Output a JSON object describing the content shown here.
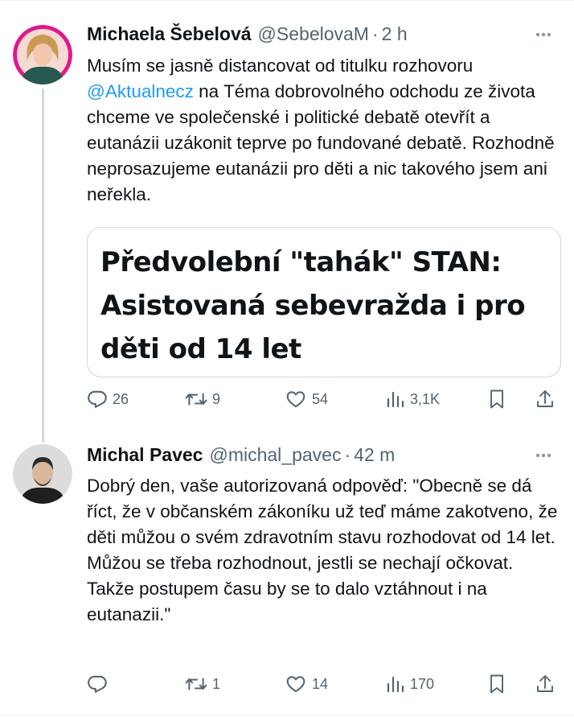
{
  "tweets": [
    {
      "author_name": "Michaela Šebelová",
      "handle": "@SebelovaM",
      "separator": "·",
      "time": "2 h",
      "text_before_mention": "Musím se jasně distancovat od titulku rozhovoru ",
      "mention": "@Aktualnecz",
      "text_after_mention": " na Téma dobrovolného odchodu ze života chceme ve společenské i politické debatě otevřít a eutanázii uzákonit teprve po fundované debatě. Rozhodně neprosazujeme eutanázii pro děti a nic takového jsem ani neřekla.",
      "card_title": "Předvolební \"tahák\" STAN: Asistovaná sebevražda i pro děti od 14 let",
      "replies": "26",
      "retweets": "9",
      "likes": "54",
      "views": "3,1K"
    },
    {
      "author_name": "Michal Pavec",
      "handle": "@michal_pavec",
      "separator": "·",
      "time": "42 m",
      "text": "Dobrý den, vaše autorizovaná odpověď: \"Obecně se dá říct, že v občanském zákoníku už teď máme zakotveno, že děti můžou o svém zdravotním stavu rozhodovat od 14 let. Můžou se třeba rozhodnout, jestli se nechají očkovat. Takže postupem času by se to dalo vztáhnout i na eutanazii.\"",
      "replies": "",
      "retweets": "1",
      "likes": "14",
      "views": "170"
    }
  ],
  "icons": {
    "more": "more-icon",
    "reply": "reply-icon",
    "retweet": "retweet-icon",
    "like": "heart-icon",
    "views": "views-icon",
    "bookmark": "bookmark-icon",
    "share": "share-icon"
  },
  "colors": {
    "text": "#0f1419",
    "secondary": "#536471",
    "link": "#1d9bf0",
    "border": "#cfd9de"
  }
}
